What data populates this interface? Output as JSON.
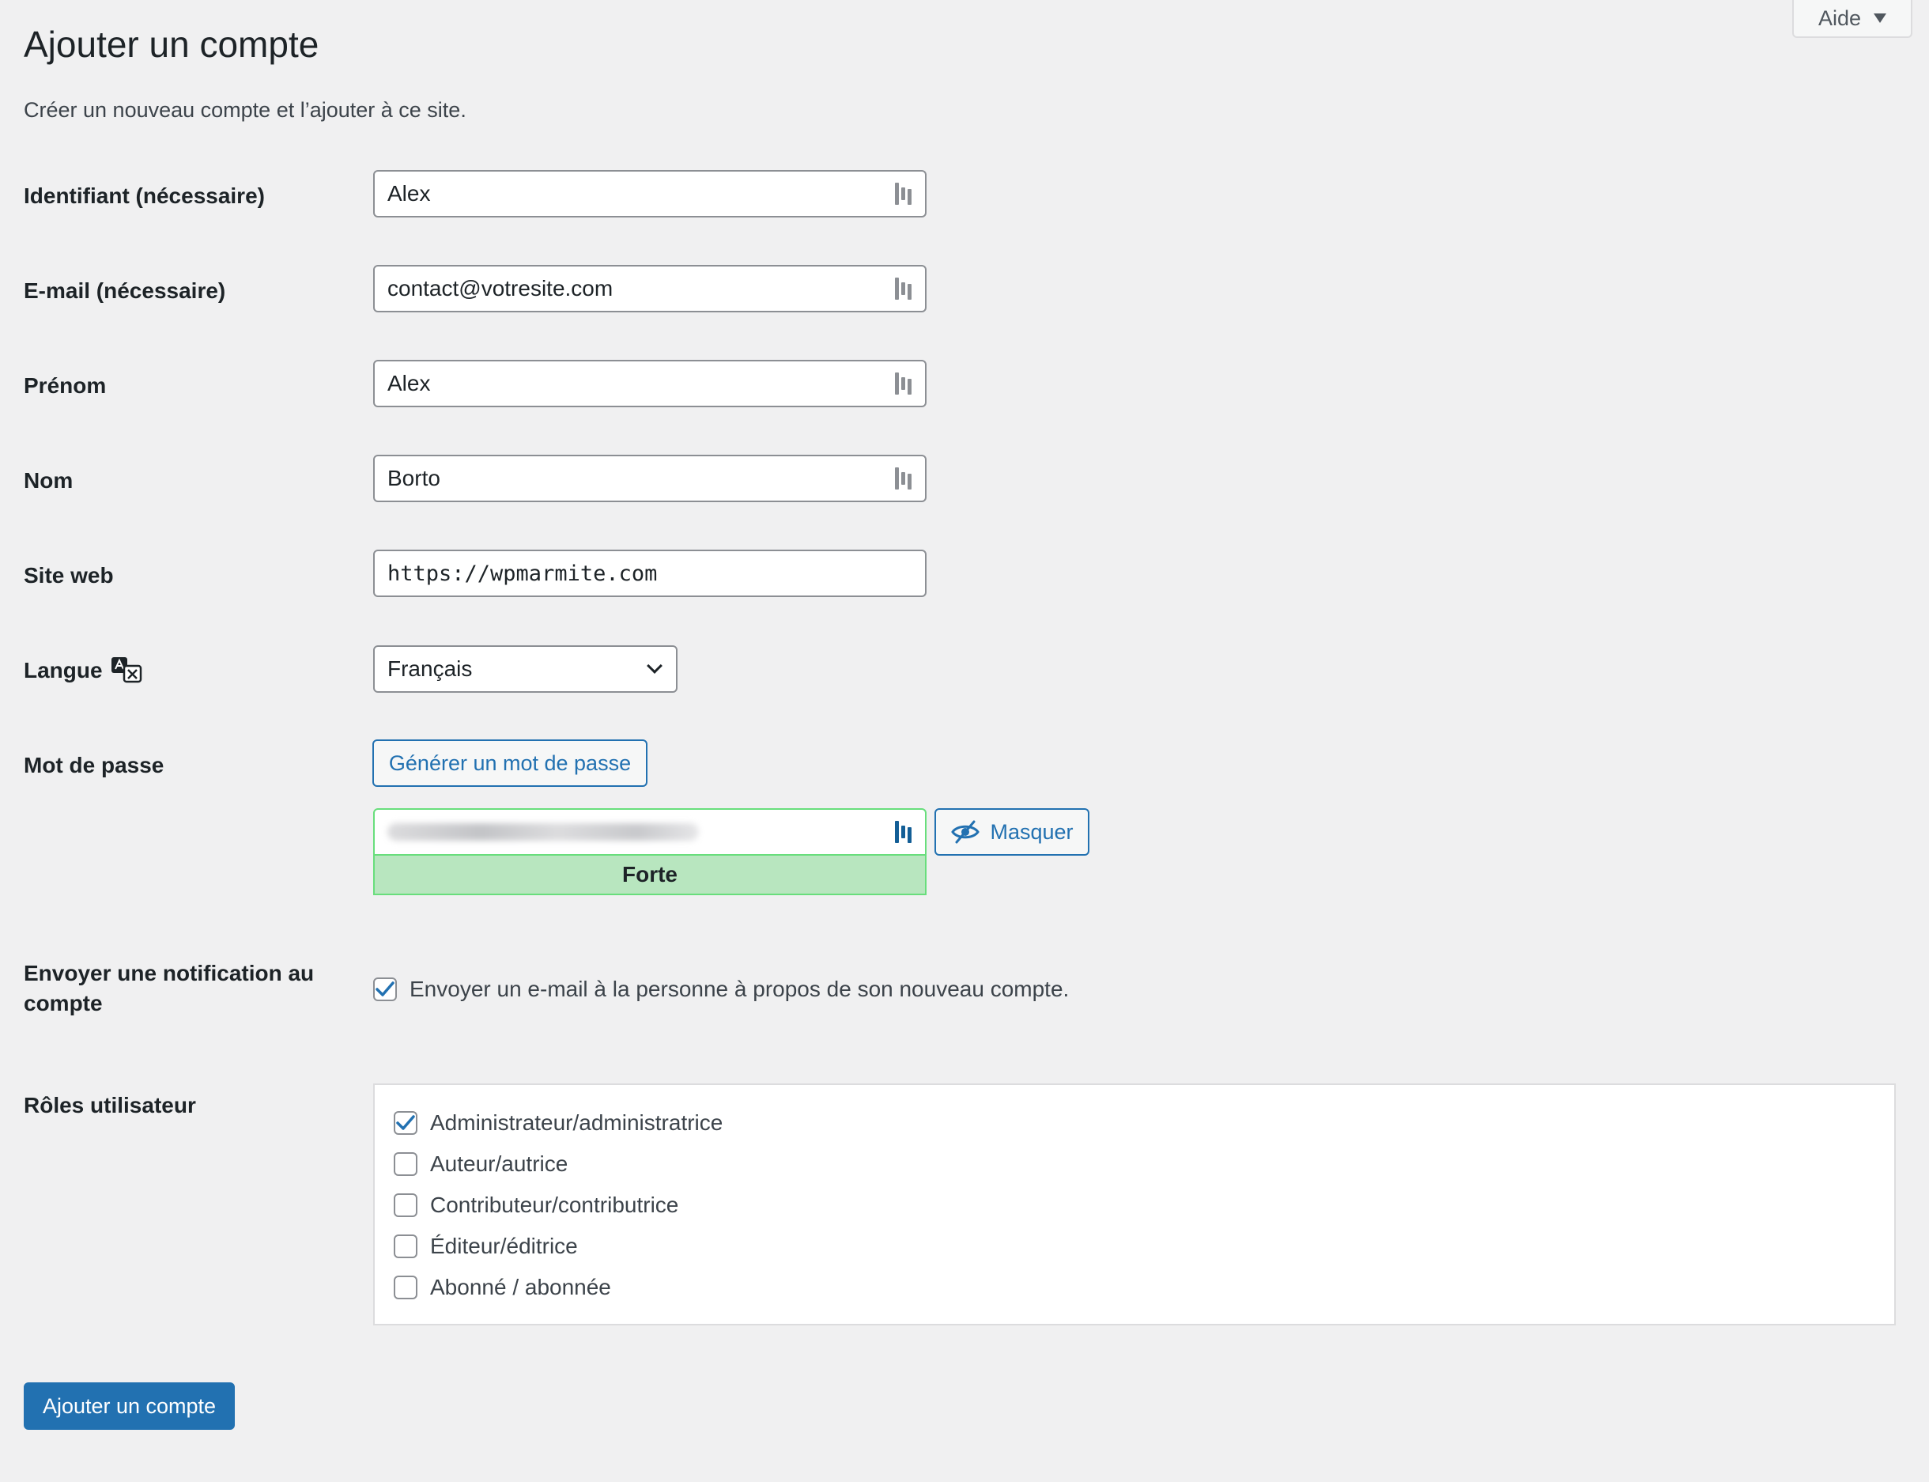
{
  "help_tab": {
    "label": "Aide"
  },
  "header": {
    "title": "Ajouter un compte",
    "description": "Créer un nouveau compte et l’ajouter à ce site."
  },
  "fields": {
    "username": {
      "label": "Identifiant (nécessaire)",
      "value": "Alex"
    },
    "email": {
      "label": "E-mail (nécessaire)",
      "value": "contact@votresite.com"
    },
    "first_name": {
      "label": "Prénom",
      "value": "Alex"
    },
    "last_name": {
      "label": "Nom",
      "value": "Borto"
    },
    "website": {
      "label": "Site web",
      "value": "https://wpmarmite.com"
    },
    "language": {
      "label": "Langue",
      "selected": "Français",
      "icon": "translate-icon"
    },
    "password": {
      "label": "Mot de passe",
      "generate_label": "Générer un mot de passe",
      "hide_label": "Masquer",
      "hide_icon": "eye-slash-icon",
      "strength": "Forte",
      "strength_color": "#b8e6bf"
    }
  },
  "notification": {
    "label": "Envoyer une notification au compte",
    "checkbox_label": "Envoyer un e-mail à la personne à propos de son nouveau compte.",
    "checked": true
  },
  "roles": {
    "label": "Rôles utilisateur",
    "items": [
      {
        "label": "Administrateur/administratrice",
        "checked": true
      },
      {
        "label": "Auteur/autrice",
        "checked": false
      },
      {
        "label": "Contributeur/contributrice",
        "checked": false
      },
      {
        "label": "Éditeur/éditrice",
        "checked": false
      },
      {
        "label": "Abonné / abonnée",
        "checked": false
      }
    ]
  },
  "submit": {
    "label": "Ajouter un compte"
  },
  "colors": {
    "accent": "#2271b1",
    "background": "#f0f0f1",
    "strong_border": "#68de7c"
  }
}
